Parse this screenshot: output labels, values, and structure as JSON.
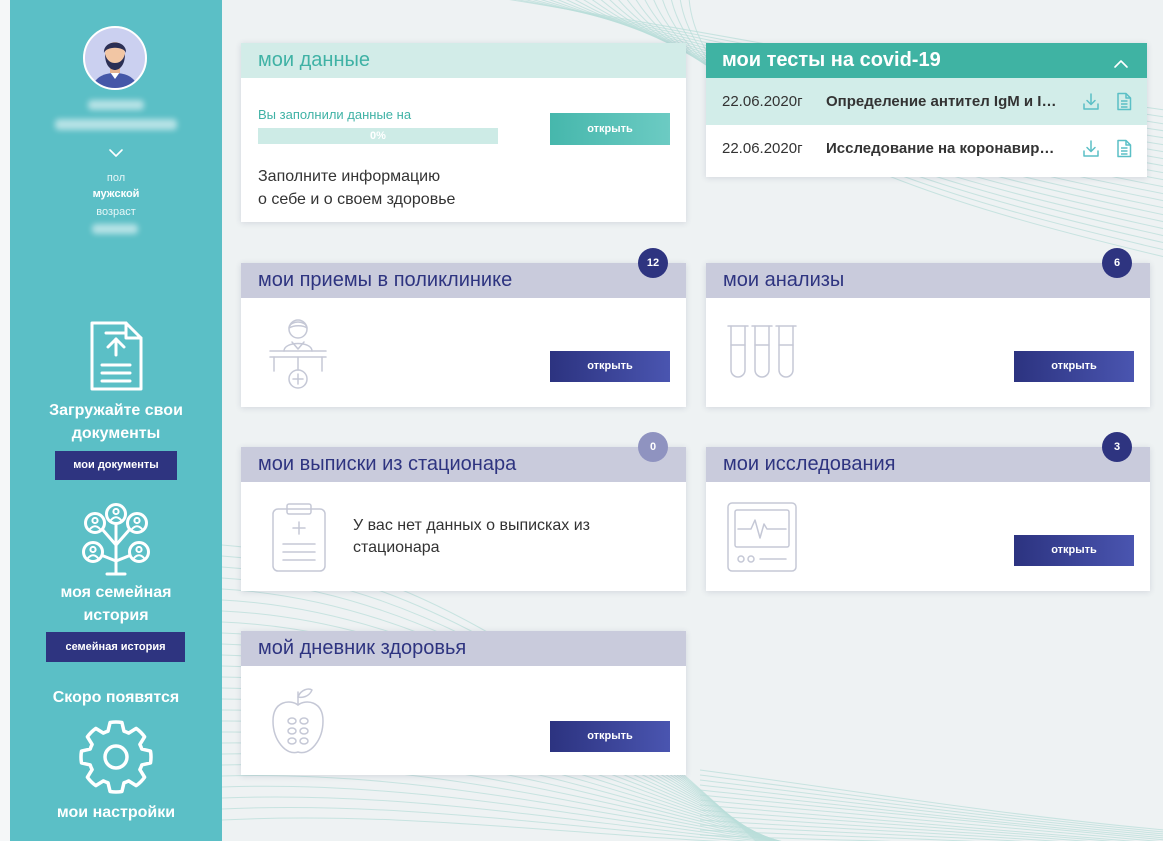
{
  "colors": {
    "sidebar": "#5bbfc6",
    "accent_teal": "#3fb3a3",
    "navy": "#2e3480",
    "badge_empty": "#8f93c0",
    "lavender_header": "#c9cbdc"
  },
  "sidebar": {
    "avatar_icon": "bearded-man-avatar",
    "gender_label": "пол",
    "gender_value": "мужской",
    "age_label": "возраст",
    "upload": {
      "icon": "document-upload-icon",
      "line1": "Загружайте свои",
      "line2": "документы",
      "button": "мои документы"
    },
    "family": {
      "icon": "family-tree-icon",
      "line1": "моя семейная",
      "line2": "история",
      "button": "семейная история"
    },
    "coming_soon": "Скоро появятся",
    "settings": {
      "icon": "gear-icon",
      "label": "мои настройки"
    }
  },
  "my_data": {
    "title": "мои данные",
    "progress_label": "Вы заполнили данные на",
    "progress_text": "0%",
    "progress_fraction": 0,
    "button": "открыть",
    "hint_line1": "Заполните информацию",
    "hint_line2": "о себе и о своем здоровье"
  },
  "covid": {
    "title": "мои тесты на covid-19",
    "rows": [
      {
        "date": "22.06.2020г",
        "title": "Определение антител IgM и I…"
      },
      {
        "date": "22.06.2020г",
        "title": "Исследование на коронавир…"
      }
    ]
  },
  "visits": {
    "title": "мои приемы в поликлинике",
    "badge": "12",
    "button": "открыть",
    "icon": "doctor-at-desk-icon"
  },
  "analyses": {
    "title": "мои анализы",
    "badge": "6",
    "button": "открыть",
    "icon": "test-tubes-icon"
  },
  "discharges": {
    "title": "мои выписки из стационара",
    "badge": "0",
    "icon": "clipboard-icon",
    "empty_line1": "У вас нет данных о выписках из",
    "empty_line2": "стационара"
  },
  "studies": {
    "title": "мои исследования",
    "badge": "3",
    "button": "открыть",
    "icon": "heart-monitor-icon"
  },
  "diary": {
    "title": "мой дневник здоровья",
    "button": "открыть",
    "icon": "apple-icon"
  }
}
